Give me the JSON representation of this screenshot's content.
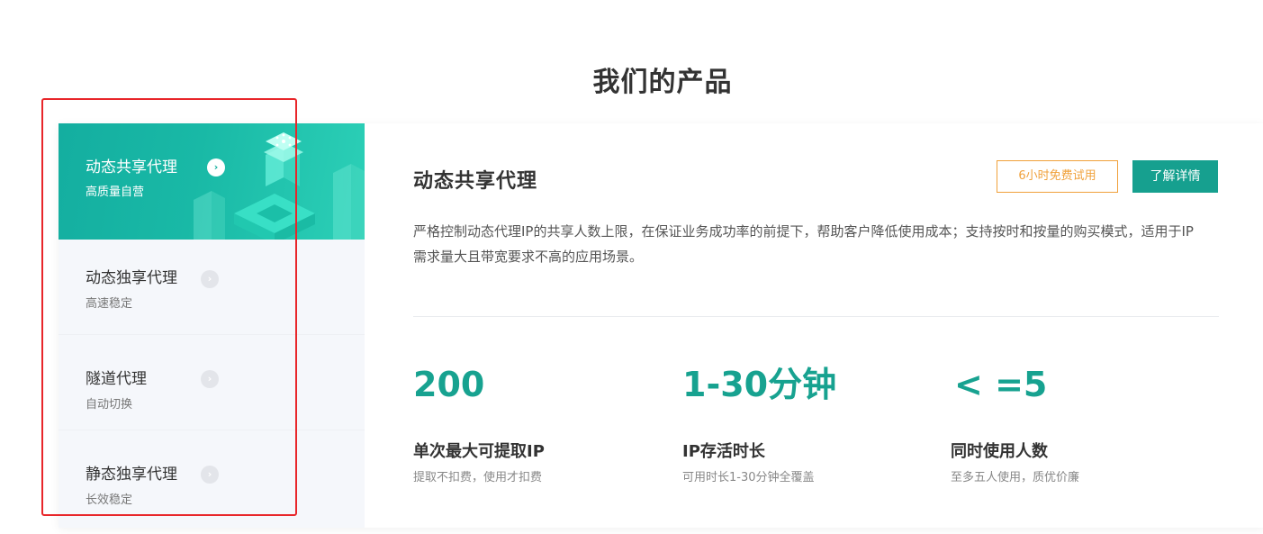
{
  "section": {
    "title": "我们的产品"
  },
  "menu": {
    "items": [
      {
        "title": "动态共享代理",
        "subtitle": "高质量自营",
        "active": true
      },
      {
        "title": "动态独享代理",
        "subtitle": "高速稳定",
        "active": false
      },
      {
        "title": "隧道代理",
        "subtitle": "自动切换",
        "active": false
      },
      {
        "title": "静态独享代理",
        "subtitle": "长效稳定",
        "active": false
      }
    ],
    "arrow_glyph": "›"
  },
  "product": {
    "title": "动态共享代理",
    "trial_button": "6小时免费试用",
    "detail_button": "了解详情",
    "description": "严格控制动态代理IP的共享人数上限，在保证业务成功率的前提下，帮助客户降低使用成本；支持按时和按量的购买模式，适用于IP需求量大且带宽要求不高的应用场景。"
  },
  "stats": [
    {
      "value": "200",
      "label": "单次最大可提取IP",
      "desc": "提取不扣费，使用才扣费"
    },
    {
      "value": "1-30分钟",
      "label": "IP存活时长",
      "desc": "可用时长1-30分钟全覆盖"
    },
    {
      "value": "< =5",
      "label": "同时使用人数",
      "desc": "至多五人使用，质优价廉"
    }
  ],
  "colors": {
    "accent": "#16a08f",
    "trial": "#f0a13b",
    "highlight": "#e8262a"
  }
}
